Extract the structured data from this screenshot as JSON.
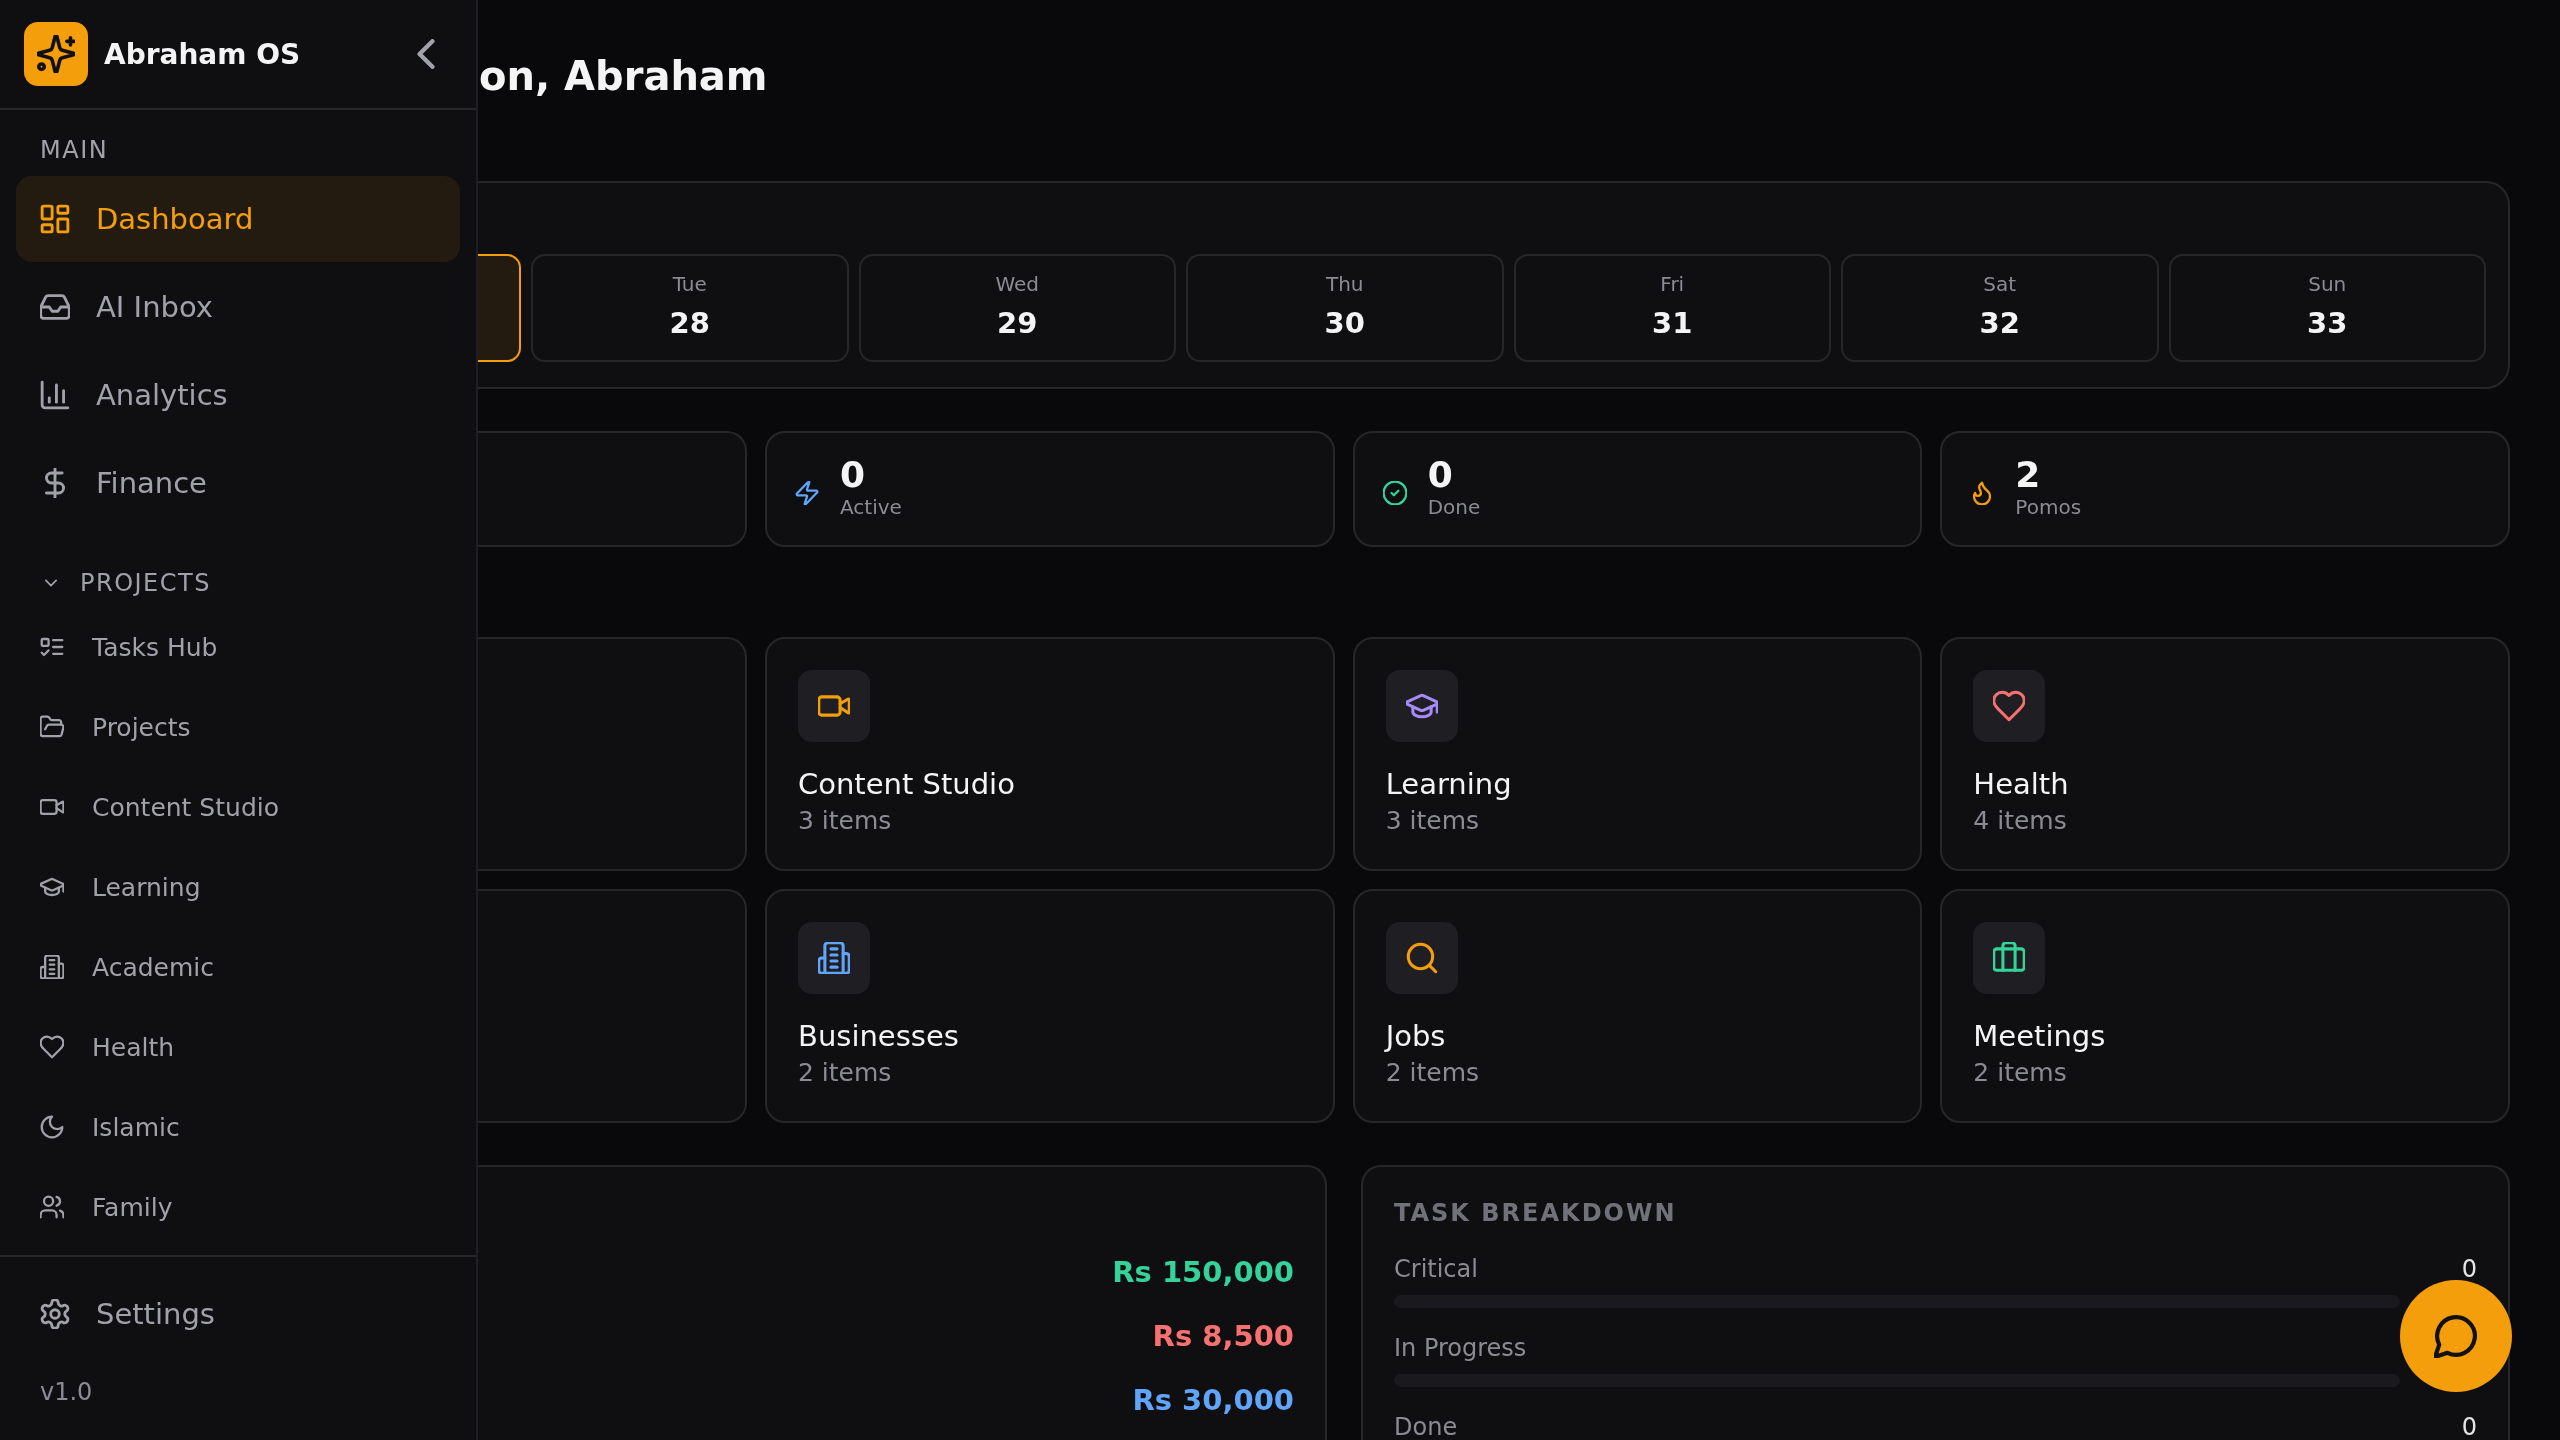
{
  "sidebar": {
    "brand": "Abraham OS",
    "section_label": "MAIN",
    "main_items": [
      {
        "label": "Dashboard",
        "selected": true
      },
      {
        "label": "AI Inbox",
        "selected": false
      },
      {
        "label": "Analytics",
        "selected": false
      },
      {
        "label": "Finance",
        "selected": false
      }
    ],
    "projects": {
      "label": "PROJECTS",
      "expanded": true,
      "items": [
        {
          "label": "Tasks Hub",
          "selected": false
        },
        {
          "label": "Projects",
          "selected": false
        },
        {
          "label": "Content Studio",
          "selected": false
        },
        {
          "label": "Learning",
          "selected": false
        },
        {
          "label": "Academic",
          "selected": false
        },
        {
          "label": "Health",
          "selected": false
        },
        {
          "label": "Islamic",
          "selected": false
        },
        {
          "label": "Family",
          "selected": false
        }
      ]
    },
    "settings": "Settings",
    "version": "v1.0"
  },
  "header": {
    "greeting": "on, Abraham"
  },
  "week": {
    "days": [
      {
        "kind": "partial",
        "selected": true
      },
      {
        "kind": "full",
        "day": "Tue",
        "date": "28",
        "selected": false
      },
      {
        "kind": "full",
        "day": "Wed",
        "date": "29",
        "selected": false
      },
      {
        "kind": "full",
        "day": "Thu",
        "date": "30",
        "selected": false
      },
      {
        "kind": "full",
        "day": "Fri",
        "date": "31",
        "selected": false
      },
      {
        "kind": "full",
        "day": "Sat",
        "date": "32",
        "selected": false
      },
      {
        "kind": "full",
        "day": "Sun",
        "date": "33",
        "selected": false
      }
    ]
  },
  "stats": [
    {
      "kind": "partial"
    },
    {
      "kind": "full",
      "value": "0",
      "label": "Active",
      "color": "#60a5fa"
    },
    {
      "kind": "full",
      "value": "0",
      "label": "Done",
      "color": "#34d399"
    },
    {
      "kind": "full",
      "value": "2",
      "label": "Pomos",
      "color": "#f59e0b"
    }
  ],
  "categories": [
    {
      "kind": "partial"
    },
    {
      "kind": "full",
      "name": "Content Studio",
      "count": "3 items",
      "color": "#f59e0b"
    },
    {
      "kind": "full",
      "name": "Learning",
      "count": "3 items",
      "color": "#a78bfa"
    },
    {
      "kind": "full",
      "name": "Health",
      "count": "4 items",
      "color": "#f87171"
    },
    {
      "kind": "partial"
    },
    {
      "kind": "full",
      "name": "Businesses",
      "count": "2 items",
      "color": "#60a5fa"
    },
    {
      "kind": "full",
      "name": "Jobs",
      "count": "2 items",
      "color": "#f59e0b"
    },
    {
      "kind": "full",
      "name": "Meetings",
      "count": "2 items",
      "color": "#34d399"
    }
  ],
  "finance": {
    "amounts": [
      {
        "value": "Rs 150,000",
        "color": "#34d399"
      },
      {
        "value": "Rs 8,500",
        "color": "#f87171"
      },
      {
        "value": "Rs 30,000",
        "color": "#60a5fa"
      }
    ]
  },
  "task_breakdown": {
    "title": "TASK BREAKDOWN",
    "rows": [
      {
        "label": "Critical",
        "count": "0",
        "level": 0
      },
      {
        "label": "In Progress",
        "level": 0
      },
      {
        "label": "Done",
        "count": "0"
      }
    ]
  }
}
